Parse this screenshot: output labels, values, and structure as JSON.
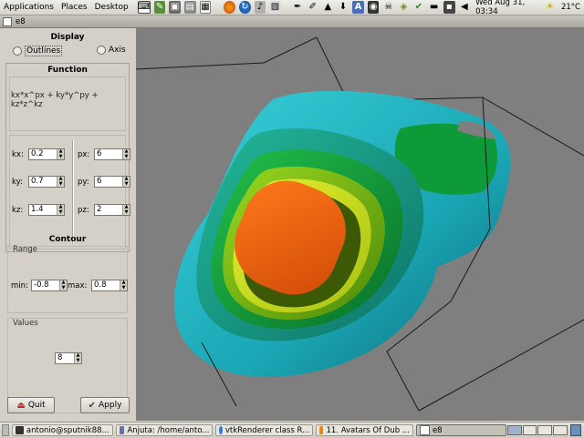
{
  "top_panel": {
    "menus": [
      "Applications",
      "Places",
      "Desktop"
    ],
    "clock": "Wed Aug 31, 03:34",
    "weather": "21°C"
  },
  "window": {
    "title": "e8"
  },
  "display": {
    "title": "Display",
    "outlines_label": "Outlines",
    "axis_label": "Axis"
  },
  "function": {
    "title": "Function",
    "formula": "kx*x^px + ky*y^py + kz*z^kz",
    "kx_label": "kx:",
    "kx_value": "0.2",
    "ky_label": "ky:",
    "ky_value": "0.7",
    "kz_label": "kz:",
    "kz_value": "1.4",
    "px_label": "px:",
    "px_value": "6",
    "py_label": "py:",
    "py_value": "6",
    "pz_label": "pz:",
    "pz_value": "2"
  },
  "contour": {
    "title": "Contour",
    "range_label": "Range",
    "min_label": "min:",
    "min_value": "-0.8",
    "max_label": "max:",
    "max_value": "0.8",
    "values_label": "Values",
    "values_value": "8"
  },
  "buttons": {
    "quit": "Quit",
    "apply": "Apply"
  },
  "taskbar": {
    "tasks": [
      "antonio@sputnik88...",
      "Anjuta: /home/anto...",
      "vtkRenderer class R...",
      "11. Avatars Of Dub ...",
      "e8"
    ]
  },
  "colors": {
    "viewport_bg": "#7f7f7f",
    "surface_cyan": "#1aa6b4",
    "surface_green": "#10a040",
    "surface_yellow": "#c6e614",
    "surface_orange": "#f06010"
  }
}
